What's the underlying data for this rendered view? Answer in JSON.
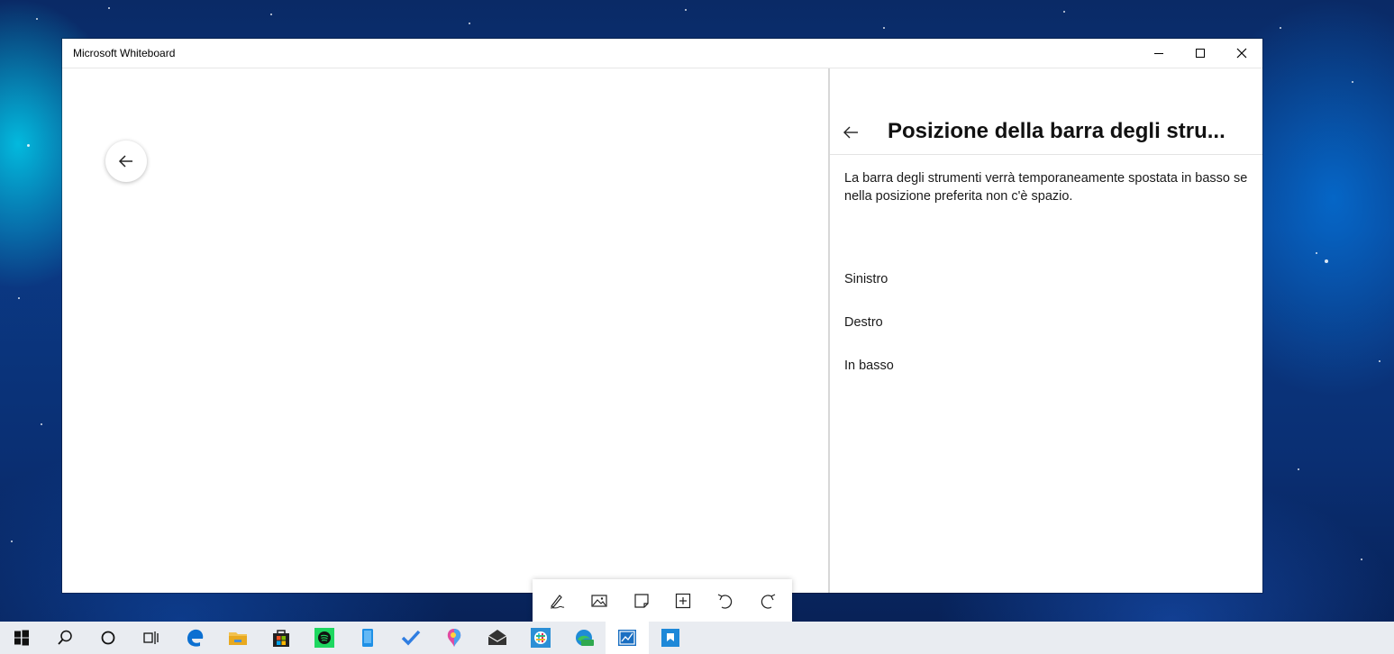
{
  "window": {
    "title": "Microsoft Whiteboard"
  },
  "pane": {
    "title": "Posizione della barra degli stru...",
    "description": "La barra degli strumenti verrà temporaneamente spostata in basso se nella posizione preferita non c'è spazio.",
    "options": [
      "Sinistro",
      "Destro",
      "In basso"
    ]
  },
  "toolbar": {
    "tools": [
      "pen-icon",
      "image-icon",
      "note-icon",
      "add-icon",
      "undo-icon",
      "redo-icon"
    ]
  },
  "taskbar": {
    "icons": [
      "windows-start-icon",
      "search-icon",
      "cortana-icon",
      "task-view-icon",
      "edge-icon",
      "file-explorer-icon",
      "store-icon",
      "spotify-icon",
      "phone-icon",
      "todo-icon",
      "paint3d-icon",
      "mail-icon",
      "slack-icon",
      "edge-beta-icon",
      "whiteboard-icon",
      "app-icon"
    ],
    "active": "whiteboard-icon"
  },
  "colors": {
    "accent": "#0078d7",
    "window_bg": "#ffffff",
    "taskbar_bg": "#e9ecf1"
  }
}
